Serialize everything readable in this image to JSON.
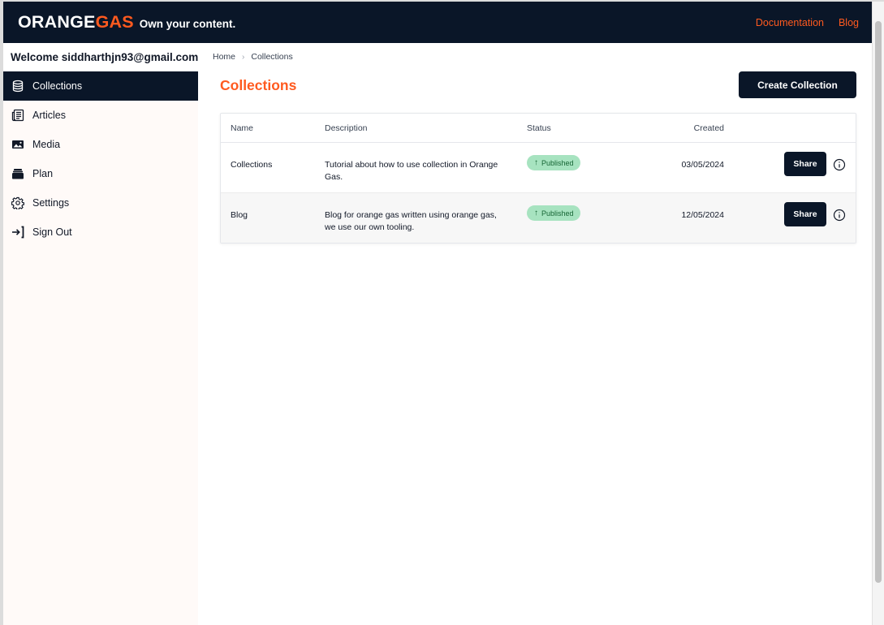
{
  "header": {
    "logo_main": "ORANGE",
    "logo_accent": "GAS",
    "tagline": "Own your content.",
    "links": [
      "Documentation",
      "Blog"
    ]
  },
  "sidebar": {
    "welcome": "Welcome siddharthjn93@gmail.com",
    "items": [
      {
        "label": "Collections",
        "icon": "database-icon",
        "active": true
      },
      {
        "label": "Articles",
        "icon": "newspaper-icon",
        "active": false
      },
      {
        "label": "Media",
        "icon": "image-icon",
        "active": false
      },
      {
        "label": "Plan",
        "icon": "wallet-icon",
        "active": false
      },
      {
        "label": "Settings",
        "icon": "gear-icon",
        "active": false
      },
      {
        "label": "Sign Out",
        "icon": "sign-out-icon",
        "active": false
      }
    ]
  },
  "breadcrumb": [
    "Home",
    "Collections"
  ],
  "page": {
    "title": "Collections",
    "create_button": "Create Collection"
  },
  "table": {
    "columns": [
      "Name",
      "Description",
      "Status",
      "Created"
    ],
    "rows": [
      {
        "name": "Collections",
        "description": "Tutorial about how to use collection in Orange Gas.",
        "status": "Published",
        "created": "03/05/2024",
        "action": "Share"
      },
      {
        "name": "Blog",
        "description": "Blog for orange gas written using orange gas, we use our own tooling.",
        "status": "Published",
        "created": "12/05/2024",
        "action": "Share"
      }
    ]
  },
  "colors": {
    "navy": "#0a1628",
    "accent": "#ff5a1f",
    "badge_bg": "#a7e3c0",
    "badge_text": "#166534",
    "sidebar_bg": "#fffaf8"
  }
}
